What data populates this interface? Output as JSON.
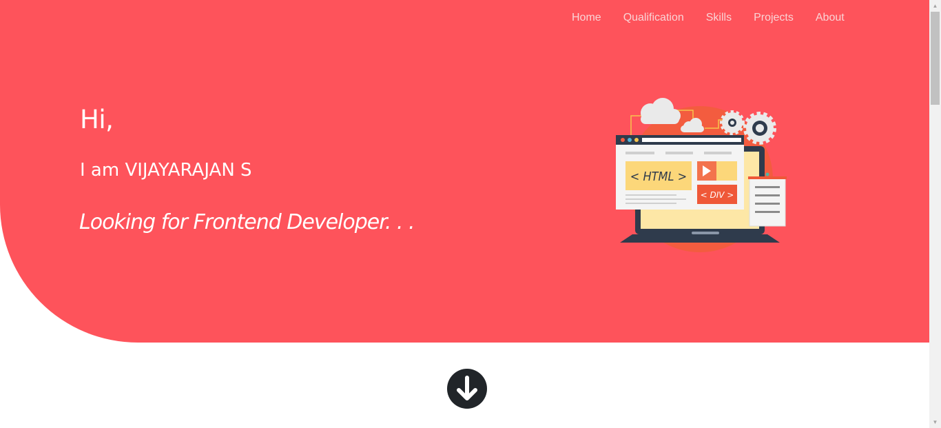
{
  "nav": {
    "items": [
      {
        "label": "Home"
      },
      {
        "label": "Qualification"
      },
      {
        "label": "Skills"
      },
      {
        "label": "Projects"
      },
      {
        "label": "About"
      }
    ]
  },
  "hero": {
    "greeting": "Hi,",
    "intro": "I am VIJAYARAJAN S",
    "tagline": "Looking for Frontend Developer. . ."
  },
  "illustration": {
    "html_label": "< HTML >",
    "div_label": "< DIV >",
    "icon": "web-development-illustration"
  },
  "scroll_button": {
    "icon": "arrow-down-circle-icon"
  },
  "colors": {
    "hero_bg": "#fe535b",
    "nav_text": "#f9d4d6",
    "scroll_button": "#212529"
  }
}
